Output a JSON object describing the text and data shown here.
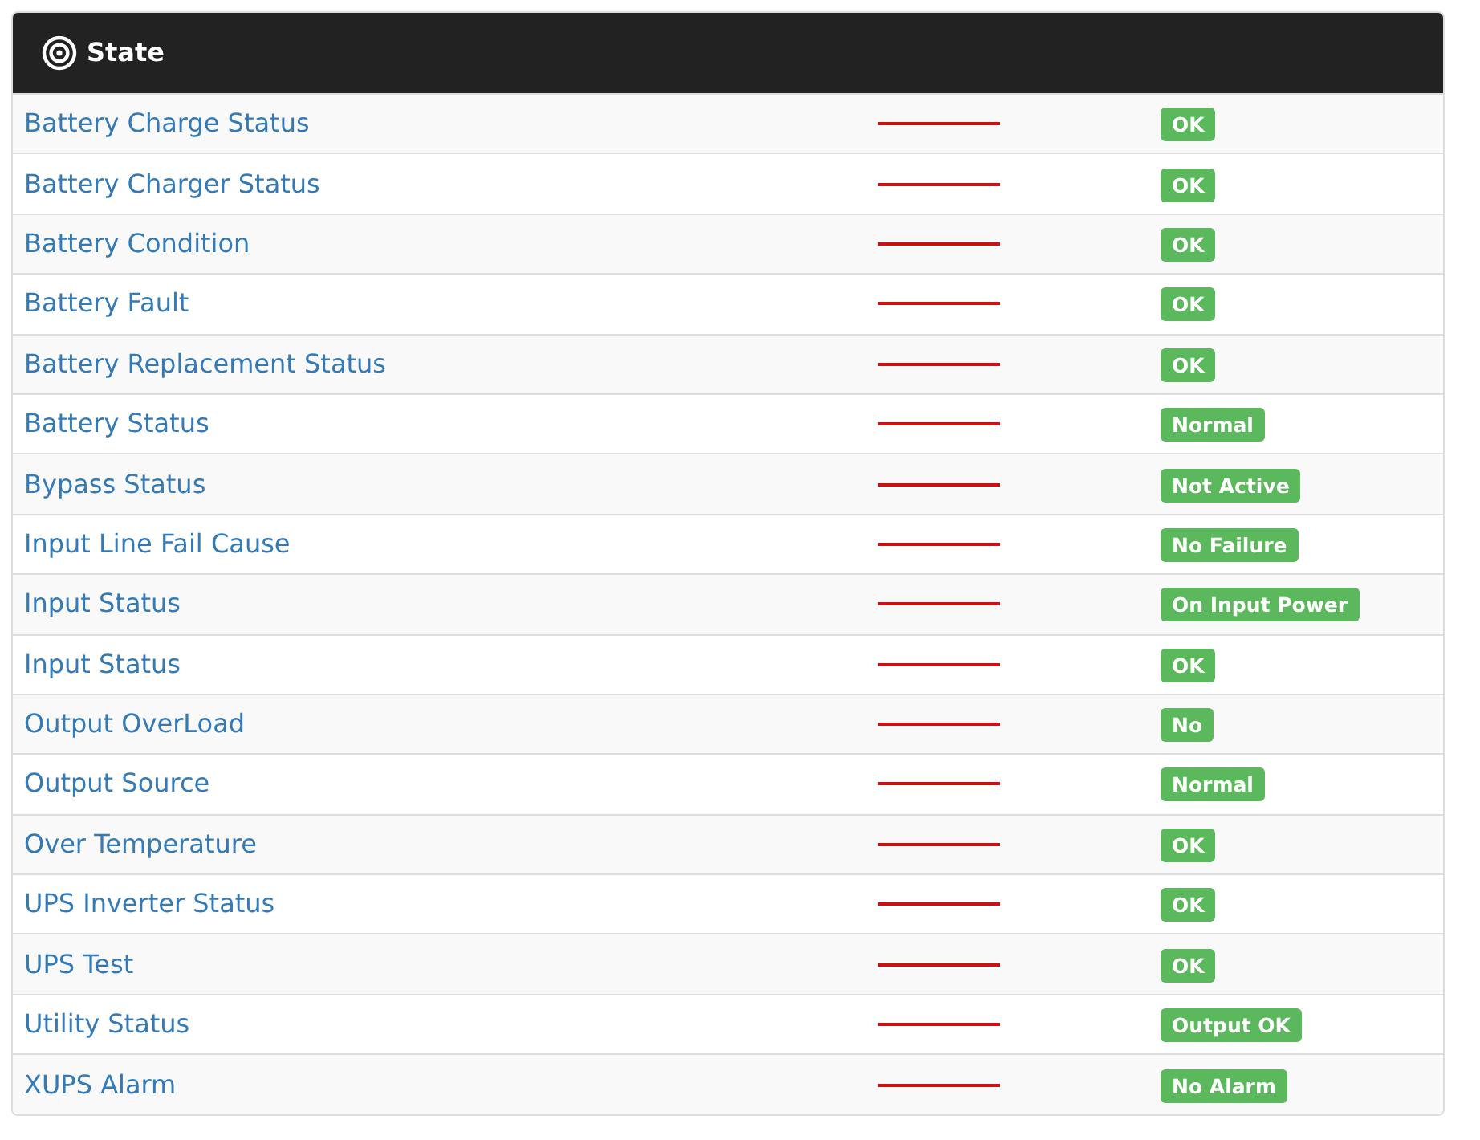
{
  "panel": {
    "title": "State"
  },
  "rows": [
    {
      "name": "Battery Charge Status",
      "status": "OK"
    },
    {
      "name": "Battery Charger Status",
      "status": "OK"
    },
    {
      "name": "Battery Condition",
      "status": "OK"
    },
    {
      "name": "Battery Fault",
      "status": "OK"
    },
    {
      "name": "Battery Replacement Status",
      "status": "OK"
    },
    {
      "name": "Battery Status",
      "status": "Normal"
    },
    {
      "name": "Bypass Status",
      "status": "Not Active"
    },
    {
      "name": "Input Line Fail Cause",
      "status": "No Failure"
    },
    {
      "name": "Input Status",
      "status": "On Input Power"
    },
    {
      "name": "Input Status",
      "status": "OK"
    },
    {
      "name": "Output OverLoad",
      "status": "No"
    },
    {
      "name": "Output Source",
      "status": "Normal"
    },
    {
      "name": "Over Temperature",
      "status": "OK"
    },
    {
      "name": "UPS Inverter Status",
      "status": "OK"
    },
    {
      "name": "UPS Test",
      "status": "OK"
    },
    {
      "name": "Utility Status",
      "status": "Output OK"
    },
    {
      "name": "XUPS Alarm",
      "status": "No Alarm"
    }
  ]
}
